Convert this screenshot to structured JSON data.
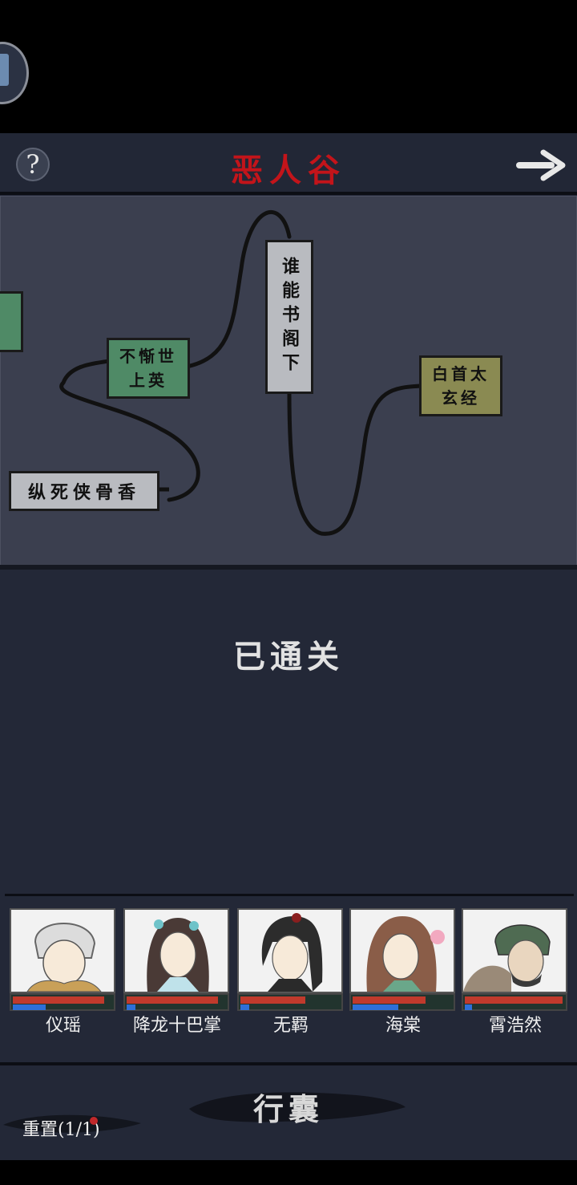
{
  "header": {
    "title": "恶人谷",
    "help_label": "?",
    "next_icon": "arrow-right-icon"
  },
  "map": {
    "nodes": [
      {
        "id": "left-edge",
        "label": "",
        "color": "green"
      },
      {
        "id": "buchi",
        "label": "不惭世上英",
        "color": "green"
      },
      {
        "id": "shuineng",
        "label": "谁能书阁下",
        "color": "gray"
      },
      {
        "id": "baishou",
        "label": "白首太玄经",
        "color": "olive"
      },
      {
        "id": "zongsi",
        "label": "纵死侠骨香",
        "color": "gray"
      }
    ]
  },
  "status": {
    "text": "已通关"
  },
  "party": {
    "members": [
      {
        "name": "仪瑶",
        "hp": 0.92,
        "mp": 0.33
      },
      {
        "name": "降龙十巴掌",
        "hp": 0.92,
        "mp": 0.09
      },
      {
        "name": "无羁",
        "hp": 0.65,
        "mp": 0.09
      },
      {
        "name": "海棠",
        "hp": 0.73,
        "mp": 0.46
      },
      {
        "name": "霄浩然",
        "hp": 0.98,
        "mp": 0.07
      }
    ]
  },
  "footer": {
    "bag_label": "行囊",
    "reset_label": "重置(1/1)"
  },
  "colors": {
    "title_red": "#c3141a",
    "hp_red": "#c03a2c",
    "mp_blue": "#2e6fd8",
    "node_green": "#4f8a66",
    "node_gray": "#b9bbc0",
    "node_olive": "#8a8a52"
  }
}
